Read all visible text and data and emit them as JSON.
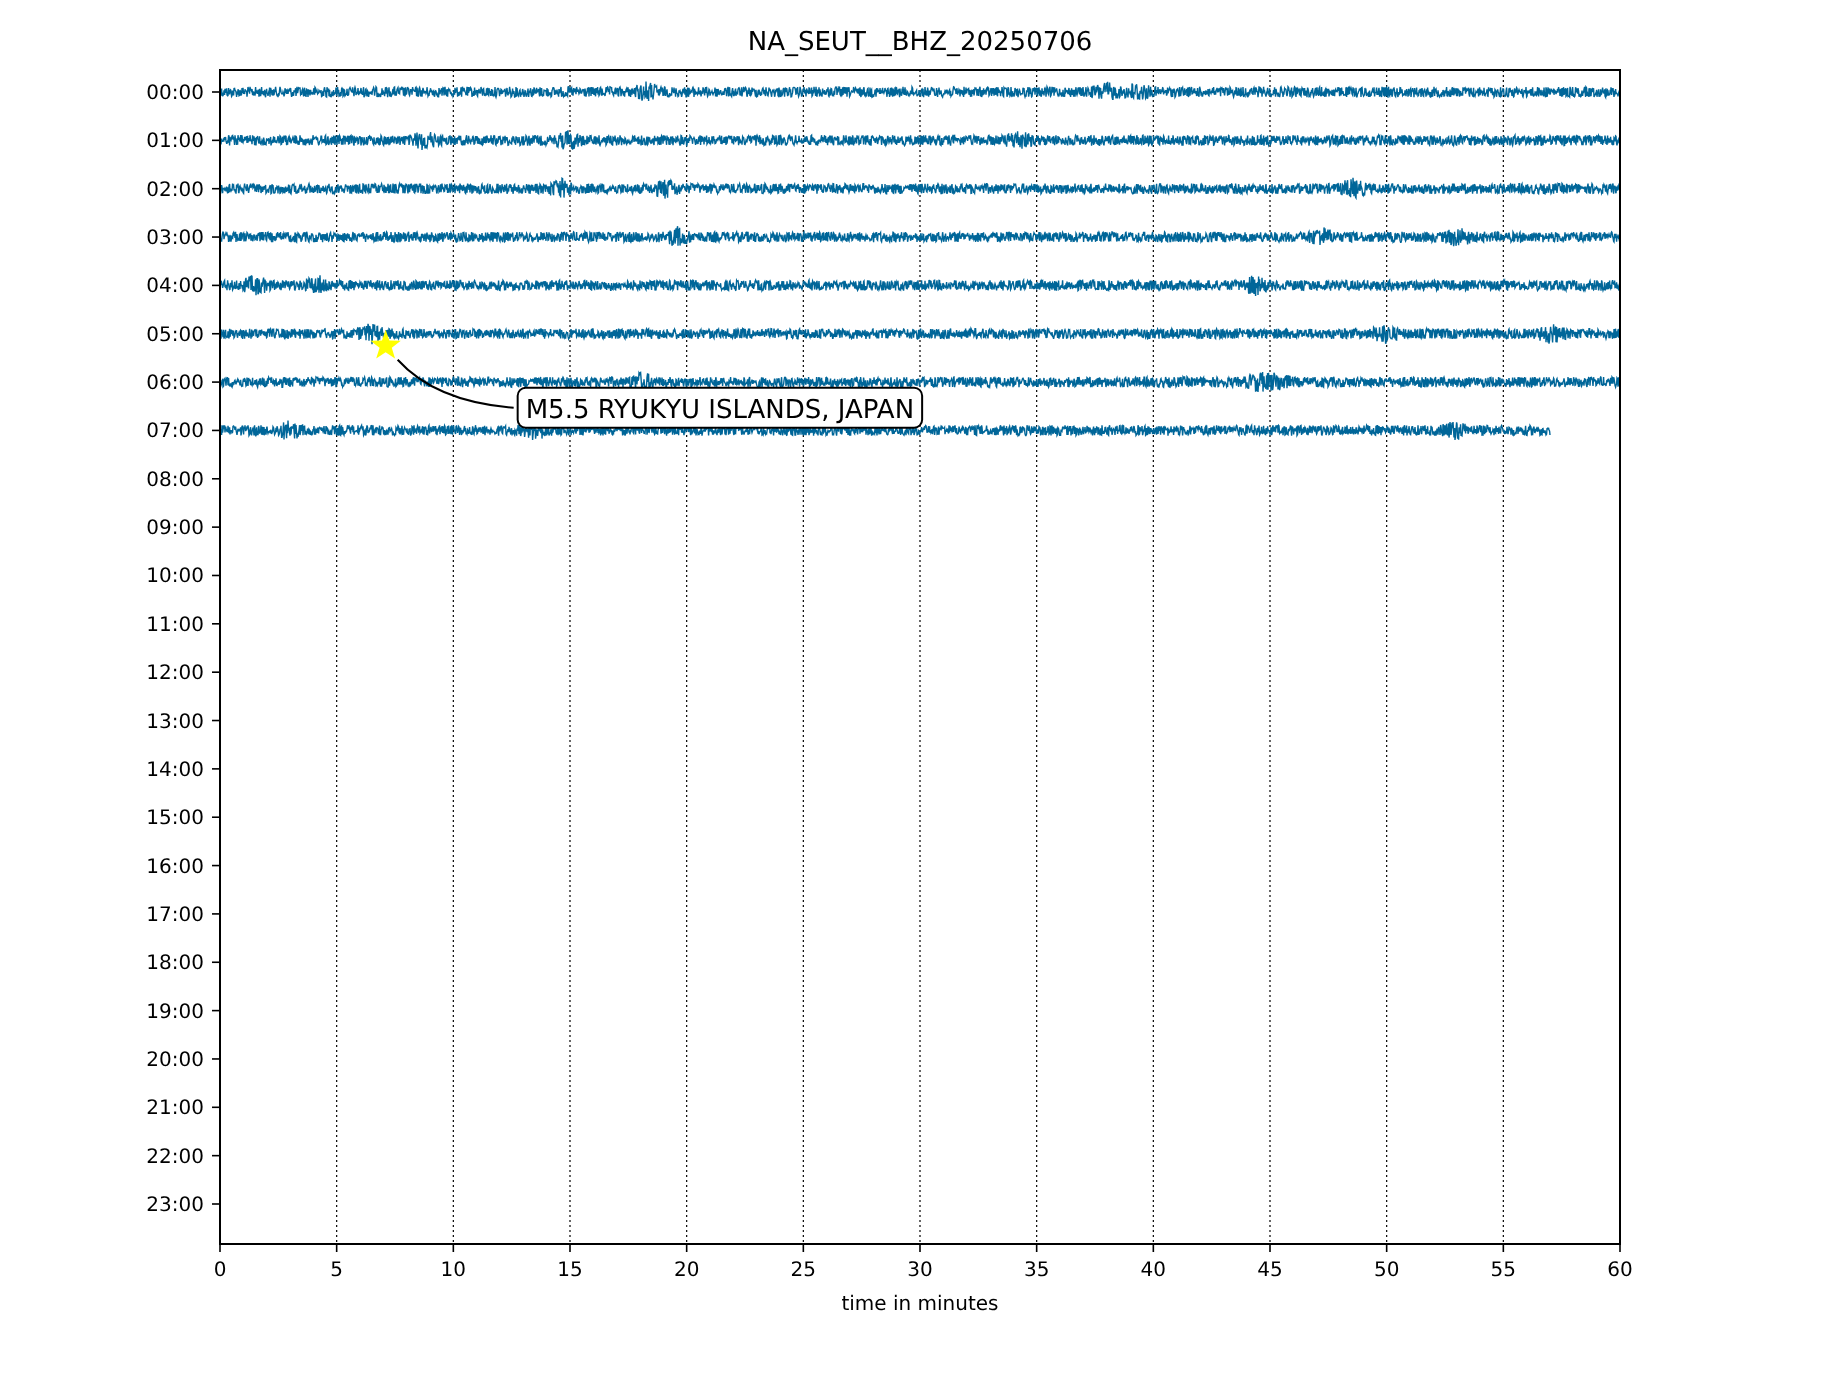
{
  "title": "NA_SEUT__BHZ_20250706",
  "xlabel": "time in minutes",
  "xticks": [
    "0",
    "5",
    "10",
    "15",
    "20",
    "25",
    "30",
    "35",
    "40",
    "45",
    "50",
    "55",
    "60"
  ],
  "rows": [
    {
      "label": "00:00",
      "level": 1,
      "event": false
    },
    {
      "label": "01:00",
      "level": 1,
      "event": false
    },
    {
      "label": "02:00",
      "level": 1,
      "event": false
    },
    {
      "label": "03:00",
      "level": 1,
      "event": false
    },
    {
      "label": "04:00",
      "level": 1,
      "event": false
    },
    {
      "label": "05:00",
      "level": 1,
      "event": true
    },
    {
      "label": "06:00",
      "level": 1,
      "event": false
    },
    {
      "label": "07:00",
      "level": 0.95,
      "event": false
    },
    {
      "label": "08:00"
    },
    {
      "label": "09:00"
    },
    {
      "label": "10:00"
    },
    {
      "label": "11:00"
    },
    {
      "label": "12:00"
    },
    {
      "label": "13:00"
    },
    {
      "label": "14:00"
    },
    {
      "label": "15:00"
    },
    {
      "label": "16:00"
    },
    {
      "label": "17:00"
    },
    {
      "label": "18:00"
    },
    {
      "label": "19:00"
    },
    {
      "label": "20:00"
    },
    {
      "label": "21:00"
    },
    {
      "label": "22:00"
    },
    {
      "label": "23:00"
    }
  ],
  "annotation": "M5.5 RYUKYU ISLANDS, JAPAN"
}
